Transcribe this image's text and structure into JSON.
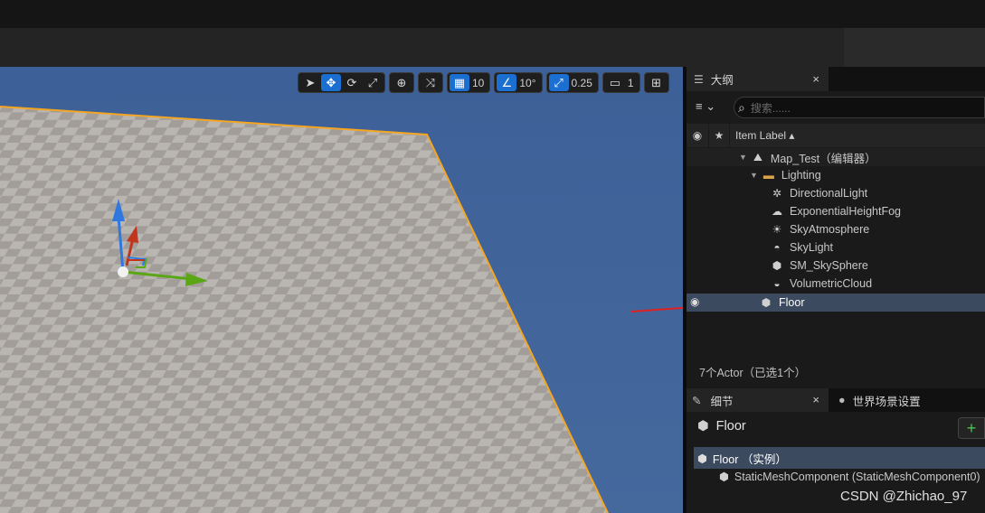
{
  "viewport": {
    "toolbar": {
      "grid_snap_value": "10",
      "rotation_snap_value": "10°",
      "scale_snap_value": "0.25",
      "camera_speed_value": "1"
    }
  },
  "outliner": {
    "tab_label": "大纲",
    "tab_close": "×",
    "search_placeholder": "搜索......",
    "column_label": "Item Label ▴",
    "map_label": "Map_Test（编辑器）",
    "folder_label": "Lighting",
    "items": [
      {
        "label": "DirectionalLight",
        "icon": "directional-light-icon"
      },
      {
        "label": "ExponentialHeightFog",
        "icon": "fog-icon"
      },
      {
        "label": "SkyAtmosphere",
        "icon": "sky-atmosphere-icon"
      },
      {
        "label": "SkyLight",
        "icon": "sky-light-icon"
      },
      {
        "label": "SM_SkySphere",
        "icon": "static-mesh-icon"
      },
      {
        "label": "VolumetricCloud",
        "icon": "cloud-icon"
      }
    ],
    "selected_item": "Floor",
    "status": "7个Actor（已选1个）"
  },
  "details": {
    "tab_label": "细节",
    "tab_close": "×",
    "world_settings_tab": "世界场景设置",
    "title": "Floor",
    "add_label": "+",
    "root_component": "Floor （实例）",
    "child_component": "StaticMeshComponent (StaticMeshComponent0)"
  },
  "watermark": "CSDN @Zhichao_97",
  "colors": {
    "accent": "#1a6fd1",
    "selection": "#3b4a5f",
    "sky": "#4168a0",
    "floor_outline": "#f4a623"
  }
}
